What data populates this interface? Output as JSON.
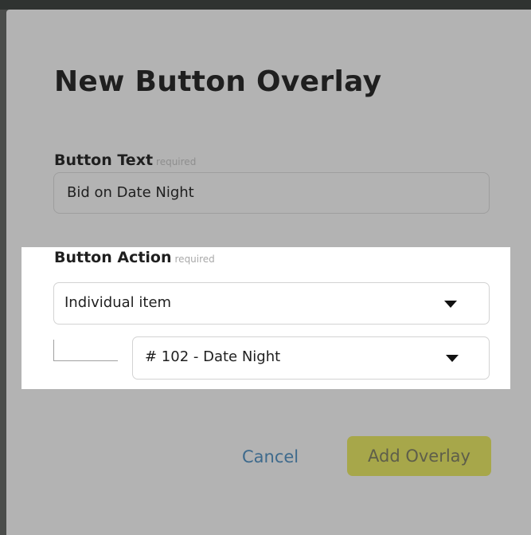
{
  "modal": {
    "title": "New Button Overlay",
    "fields": {
      "button_text": {
        "label": "Button Text",
        "required_hint": "required",
        "value": "Bid on Date Night"
      },
      "button_action": {
        "label": "Button Action",
        "required_hint": "required",
        "action_type": "Individual item",
        "item": "# 102 - Date Night"
      }
    },
    "buttons": {
      "cancel": "Cancel",
      "submit": "Add Overlay"
    }
  },
  "icons": {
    "action_dropdown": "caret-down-icon",
    "item_dropdown": "caret-down-icon"
  },
  "colors": {
    "overlay_bg": "#b3b3b3",
    "highlight_bg": "#ffffff",
    "cancel_link": "#3e6a8c",
    "submit_bg": "#a7a74a"
  }
}
